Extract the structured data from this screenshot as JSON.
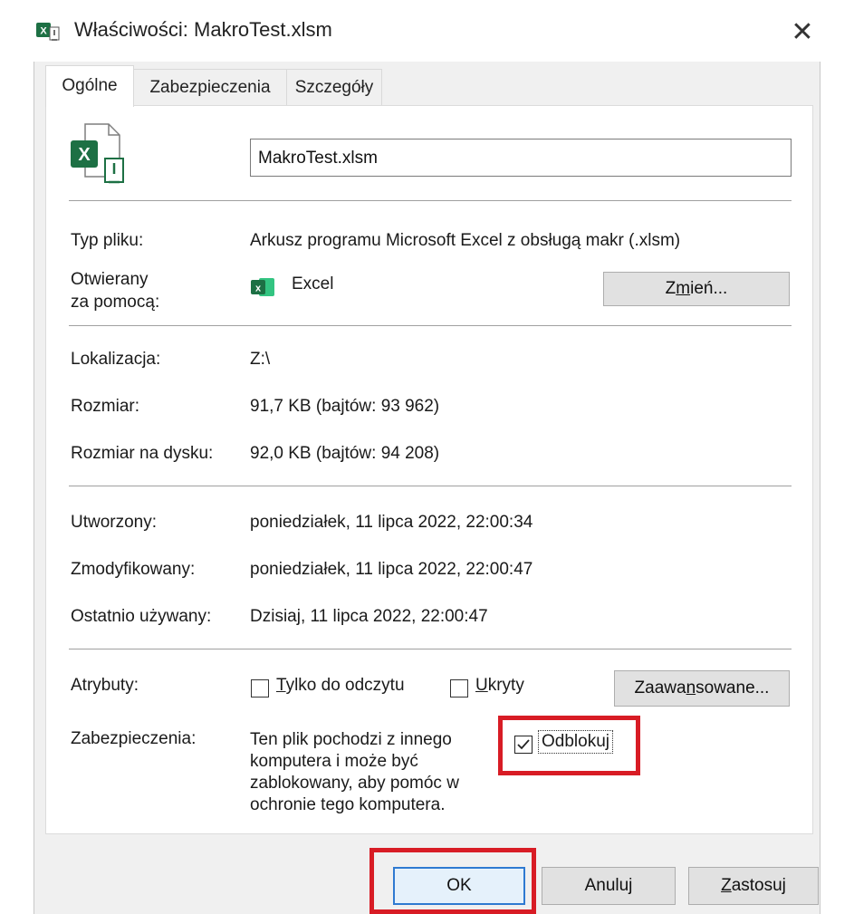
{
  "window": {
    "title": "Właściwości: MakroTest.xlsm",
    "close_glyph": "✕"
  },
  "tabs": [
    {
      "label": "Ogólne",
      "active": true
    },
    {
      "label": "Zabezpieczenia",
      "active": false
    },
    {
      "label": "Szczegóły",
      "active": false
    }
  ],
  "general": {
    "file_name": "MakroTest.xlsm",
    "type_label": "Typ pliku:",
    "type_value": "Arkusz programu Microsoft Excel z obsługą makr (.xlsm)",
    "opens_with_label_line1": "Otwierany",
    "opens_with_label_line2": "za pomocą:",
    "opens_with_app": "Excel",
    "change_button": {
      "pre": "Z",
      "mnemonic": "m",
      "post": "ień..."
    },
    "location_label": "Lokalizacja:",
    "location_value": "Z:\\",
    "size_label": "Rozmiar:",
    "size_value": "91,7 KB (bajtów: 93 962)",
    "size_on_disk_label": "Rozmiar na dysku:",
    "size_on_disk_value": "92,0 KB (bajtów: 94 208)",
    "created_label": "Utworzony:",
    "created_value": "poniedziałek, 11 lipca 2022, 22:00:34",
    "modified_label": "Zmodyfikowany:",
    "modified_value": "poniedziałek, 11 lipca 2022, 22:00:47",
    "accessed_label": "Ostatnio używany:",
    "accessed_value": "Dzisiaj, 11 lipca 2022, 22:00:47",
    "attributes_label": "Atrybuty:",
    "readonly": {
      "mnemonic": "T",
      "post": "ylko do odczytu",
      "checked": false
    },
    "hidden": {
      "mnemonic": "U",
      "post": "kryty",
      "checked": false
    },
    "advanced_button": {
      "pre": "Zaawa",
      "mnemonic": "n",
      "post": "sowane..."
    },
    "security_label": "Zabezpieczenia:",
    "security_text": "Ten plik pochodzi z innego komputera i może być zablokowany, aby pomóc w ochronie tego komputera.",
    "unblock": {
      "label": "Odblokuj",
      "checked": true
    }
  },
  "buttons": {
    "ok": "OK",
    "cancel": "Anuluj",
    "apply": {
      "mnemonic": "Z",
      "post": "astosuj"
    }
  },
  "colors": {
    "highlight_red": "#d81c25",
    "excel_green": "#1d7044",
    "focus_blue": "#2f7ad1"
  }
}
